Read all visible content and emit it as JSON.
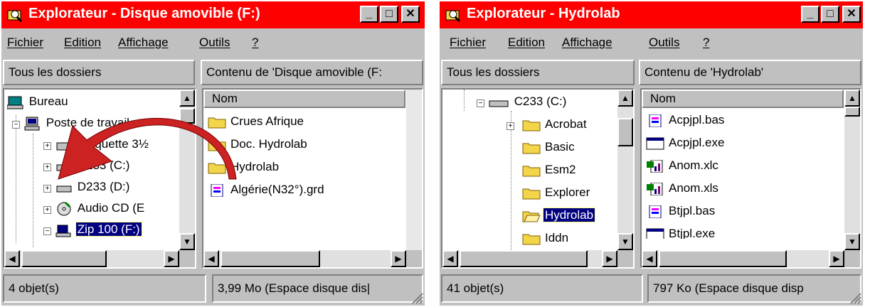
{
  "left": {
    "title": "Explorateur - Disque amovible (F:)",
    "menu": [
      "Fichier",
      "Edition",
      "Affichage",
      "Outils",
      "?"
    ],
    "tree_header": "Tous les dossiers",
    "content_header": "Contenu de 'Disque amovible (F:",
    "tree": [
      {
        "label": "Bureau",
        "icon": "desktop-icon"
      },
      {
        "label": "Poste de travail",
        "icon": "computer-icon"
      },
      {
        "label": "Disquette 3½",
        "icon": "floppy-icon"
      },
      {
        "label": "C233 (C:)",
        "icon": "drive-icon"
      },
      {
        "label": "D233 (D:)",
        "icon": "drive-icon"
      },
      {
        "label": "Audio CD (E",
        "icon": "cd-icon"
      },
      {
        "label": "Zip 100 (F:)",
        "icon": "zip-drive-icon"
      }
    ],
    "column_name": "Nom",
    "files": [
      {
        "label": "Crues Afrique",
        "icon": "folder-icon"
      },
      {
        "label": "Doc. Hydrolab",
        "icon": "folder-icon"
      },
      {
        "label": "Hydrolab",
        "icon": "folder-icon"
      },
      {
        "label": "Algérie(N32°).grd",
        "icon": "document-icon"
      }
    ],
    "status_count": "4 objet(s)",
    "status_space": "3,99 Mo (Espace disque dis|"
  },
  "right": {
    "title": "Explorateur - Hydrolab",
    "menu": [
      "Fichier",
      "Edition",
      "Affichage",
      "Outils",
      "?"
    ],
    "tree_header": "Tous les dossiers",
    "content_header": "Contenu de 'Hydrolab'",
    "tree": [
      {
        "label": "C233 (C:)",
        "icon": "drive-icon"
      },
      {
        "label": "Acrobat",
        "icon": "folder-icon"
      },
      {
        "label": "Basic",
        "icon": "folder-icon"
      },
      {
        "label": "Esm2",
        "icon": "folder-icon"
      },
      {
        "label": "Explorer",
        "icon": "folder-icon"
      },
      {
        "label": "Hydrolab",
        "icon": "open-folder-icon"
      },
      {
        "label": "Iddn",
        "icon": "folder-icon"
      }
    ],
    "column_name": "Nom",
    "files": [
      {
        "label": "Acpjpl.bas",
        "icon": "source-file-icon"
      },
      {
        "label": "Acpjpl.exe",
        "icon": "exe-icon"
      },
      {
        "label": "Anom.xlc",
        "icon": "excel-chart-icon"
      },
      {
        "label": "Anom.xls",
        "icon": "excel-chart-icon"
      },
      {
        "label": "Btjpl.bas",
        "icon": "source-file-icon"
      },
      {
        "label": "Btjpl.exe",
        "icon": "exe-icon"
      }
    ],
    "status_count": "41 objet(s)",
    "status_space": "797 Ko (Espace disque disp"
  },
  "colors": {
    "titlebar": "#ff0000",
    "selection": "#000080",
    "arrow": "#cc2222",
    "folder": "#f3d54a"
  }
}
